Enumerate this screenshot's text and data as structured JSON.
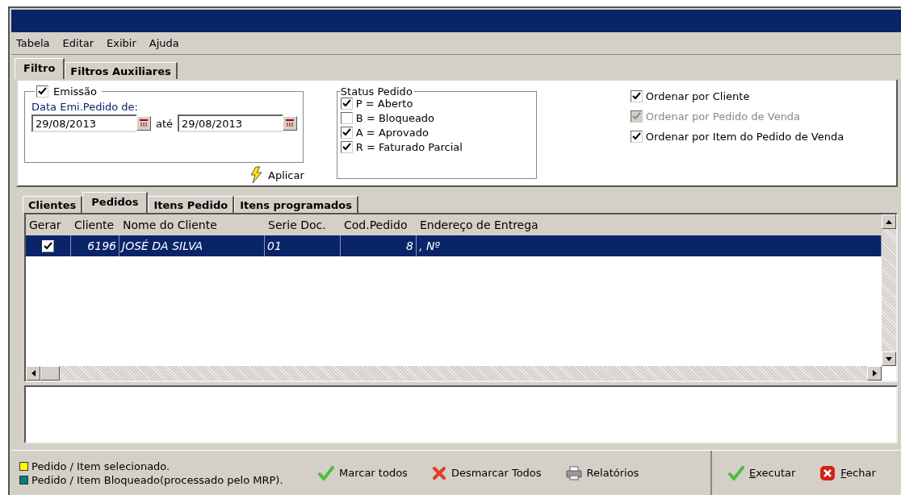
{
  "menu": [
    "Tabela",
    "Editar",
    "Exibir",
    "Ajuda"
  ],
  "tabs": [
    {
      "label": "Filtro",
      "selected": true
    },
    {
      "label": "Filtros Auxiliares",
      "selected": false
    }
  ],
  "emissao": {
    "label": "Emissão",
    "checked": true,
    "date_label": "Data Emi.Pedido de:",
    "from": "29/08/2013",
    "to_label": "até",
    "to": "29/08/2013"
  },
  "apply_button": "Aplicar",
  "status": {
    "title": "Status Pedido",
    "items": [
      {
        "label": "P = Aberto",
        "checked": true
      },
      {
        "label": "B = Bloqueado",
        "checked": false
      },
      {
        "label": "A = Aprovado",
        "checked": true
      },
      {
        "label": "R = Faturado Parcial",
        "checked": true
      }
    ]
  },
  "order_options": [
    {
      "label": "Ordenar por Cliente",
      "checked": true,
      "disabled": false
    },
    {
      "label": "Ordenar por Pedido de Venda",
      "checked": true,
      "disabled": true
    },
    {
      "label": "Ordenar por Item do Pedido de Venda",
      "checked": true,
      "disabled": false
    }
  ],
  "sub_tabs": [
    {
      "label": "Clientes",
      "selected": false
    },
    {
      "label": "Pedidos",
      "selected": true
    },
    {
      "label": "Itens Pedido",
      "selected": false
    },
    {
      "label": "Itens programados",
      "selected": false
    }
  ],
  "table": {
    "check_column": "Gerar",
    "columns": [
      "Cliente",
      "Nome do Cliente",
      "Serie Doc.",
      "Cod.Pedido",
      "Endereço de Entrega"
    ],
    "rows": [
      {
        "gerar": true,
        "selected": true,
        "cells": [
          "6196",
          "JOSÉ DA SILVA",
          "01",
          "8",
          ", Nº"
        ]
      }
    ]
  },
  "legend": [
    {
      "label": "Pedido / Item selecionado.",
      "color": "#ffff00"
    },
    {
      "label": "Pedido / Item Bloqueado(processado pelo MRP).",
      "color": "#008080"
    }
  ],
  "actions": [
    {
      "label": "Marcar todos",
      "kind": "check"
    },
    {
      "label": "Desmarcar Todos",
      "kind": "cross"
    },
    {
      "label": "Relatórios",
      "kind": "printer"
    }
  ],
  "main_actions": [
    {
      "label": "Executar",
      "kind": "check"
    },
    {
      "label": "Fechar",
      "kind": "close"
    }
  ]
}
